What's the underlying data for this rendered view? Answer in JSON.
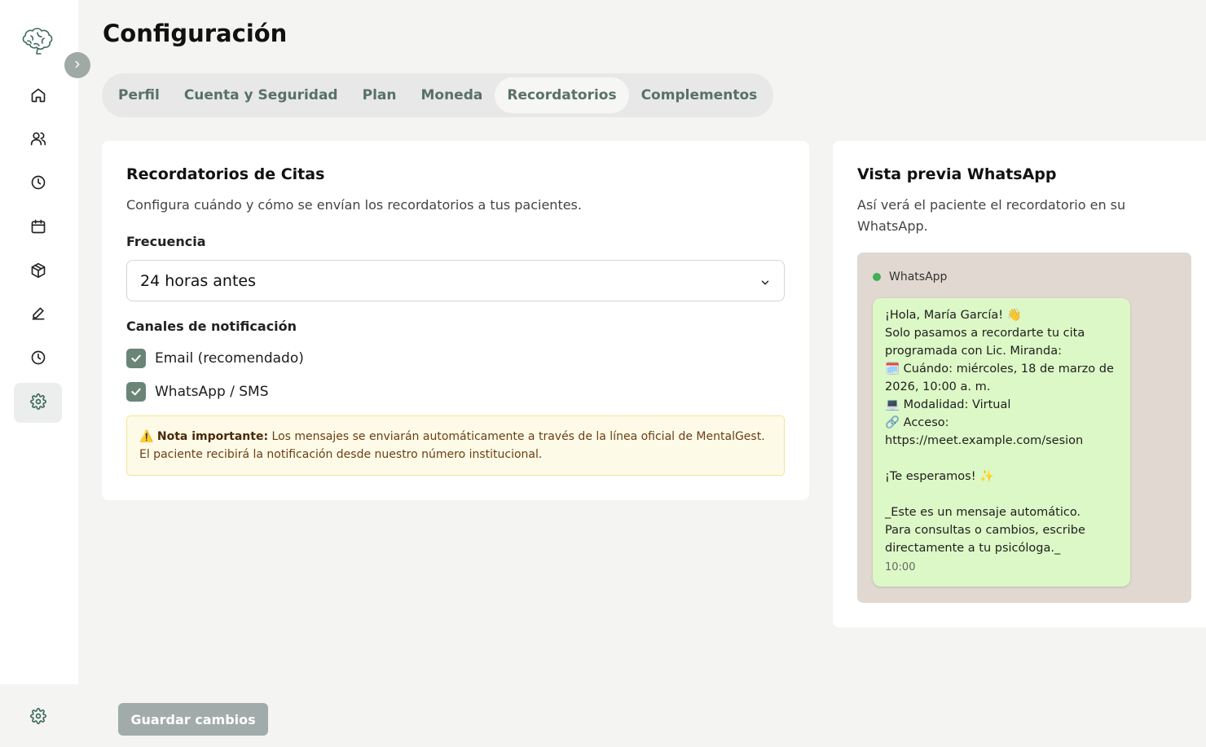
{
  "sidebar": {
    "items": [
      {
        "icon": "home-icon"
      },
      {
        "icon": "users-icon"
      },
      {
        "icon": "clock-icon"
      },
      {
        "icon": "calendar-icon"
      },
      {
        "icon": "package-icon"
      },
      {
        "icon": "pencil-icon"
      },
      {
        "icon": "history-icon"
      },
      {
        "icon": "settings-icon",
        "active": true
      }
    ],
    "bottom_icon": "settings-icon"
  },
  "page": {
    "title": "Configuración"
  },
  "tabs": [
    {
      "label": "Perfil"
    },
    {
      "label": "Cuenta y Seguridad"
    },
    {
      "label": "Plan"
    },
    {
      "label": "Moneda"
    },
    {
      "label": "Recordatorios",
      "active": true
    },
    {
      "label": "Complementos"
    }
  ],
  "reminders": {
    "title": "Recordatorios de Citas",
    "subtitle": "Configura cuándo y cómo se envían los recordatorios a tus pacientes.",
    "frequency_label": "Frecuencia",
    "frequency_value": "24 horas antes",
    "channels_label": "Canales de notificación",
    "channels": [
      {
        "label": "Email (recomendado)",
        "checked": true
      },
      {
        "label": "WhatsApp / SMS",
        "checked": true
      }
    ],
    "note_icon": "⚠️",
    "note_bold": "Nota importante:",
    "note_text": "Los mensajes se enviarán automáticamente a través de la línea oficial de MentalGest. El paciente recibirá la notificación desde nuestro número institucional."
  },
  "preview": {
    "title": "Vista previa WhatsApp",
    "subtitle": "Así verá el paciente el recordatorio en su WhatsApp.",
    "header": "WhatsApp",
    "message_lines": [
      "¡Hola, María García! 👋",
      "Solo pasamos a recordarte tu cita",
      "programada con Lic. Miranda:",
      "🗓️ Cuándo: miércoles, 18 de marzo de",
      "2026, 10:00 a. m.",
      "💻 Modalidad: Virtual",
      "🔗 Acceso:",
      "https://meet.example.com/sesion",
      "",
      "¡Te esperamos! ✨",
      "",
      "_Este es un mensaje automático.",
      "Para consultas o cambios, escribe",
      "directamente a tu psicóloga._"
    ],
    "time": "10:00"
  },
  "footer": {
    "save_label": "Guardar cambios"
  },
  "colors": {
    "accent": "#587166",
    "checkbox": "#6b8478",
    "bubble": "#dcf8c6",
    "wa_bg": "#e1d9d1",
    "note_bg": "#fdfbe8",
    "save_button": "#a1acaa"
  }
}
